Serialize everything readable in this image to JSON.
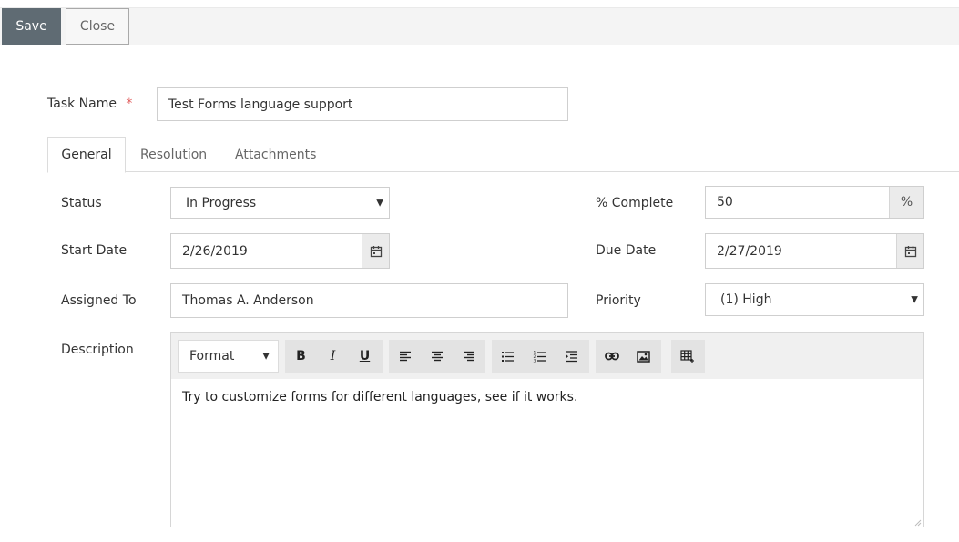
{
  "toolbar": {
    "save_label": "Save",
    "close_label": "Close"
  },
  "task": {
    "name_label": "Task Name",
    "required_marker": "*",
    "name_value": "Test Forms language support"
  },
  "tabs": [
    {
      "label": "General",
      "active": true
    },
    {
      "label": "Resolution",
      "active": false
    },
    {
      "label": "Attachments",
      "active": false
    }
  ],
  "form": {
    "status_label": "Status",
    "status_value": "In Progress",
    "percent_label": "% Complete",
    "percent_value": "50",
    "percent_unit": "%",
    "start_label": "Start Date",
    "start_value": "2/26/2019",
    "due_label": "Due Date",
    "due_value": "2/27/2019",
    "assigned_label": "Assigned To",
    "assigned_value": "Thomas A. Anderson",
    "priority_label": "Priority",
    "priority_value": "(1) High",
    "description_label": "Description"
  },
  "editor": {
    "format_label": "Format",
    "content": "Try to customize forms for different languages, see if it works.",
    "buttons": [
      "bold-icon",
      "italic-icon",
      "underline-icon",
      "align-left-icon",
      "align-center-icon",
      "align-right-icon",
      "bulleted-list-icon",
      "numbered-list-icon",
      "indent-icon",
      "link-icon",
      "image-icon",
      "table-icon"
    ]
  },
  "colors": {
    "primary_button": "#5f6b73",
    "required_marker": "#e05a5a",
    "toolbar_bg": "#f4f4f4"
  }
}
